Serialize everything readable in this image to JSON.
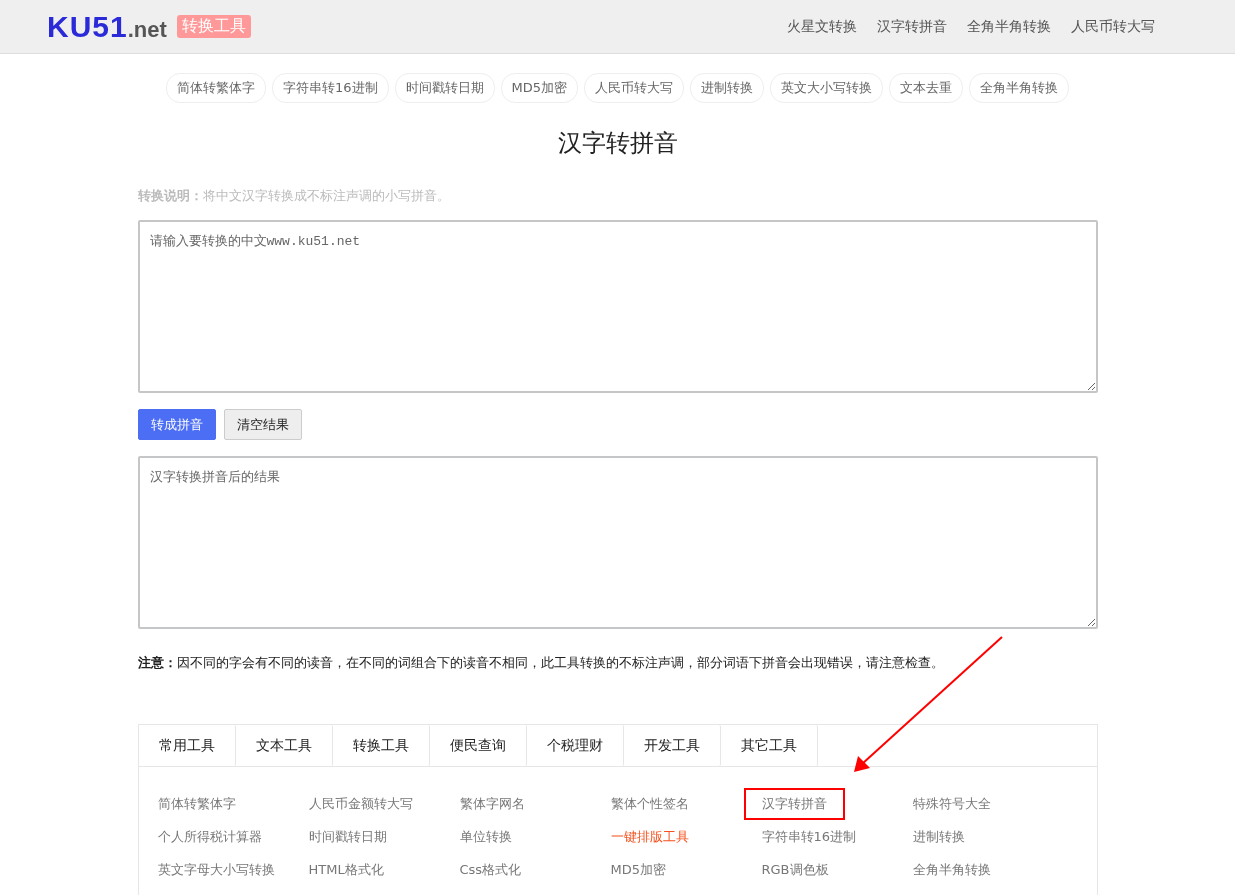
{
  "header": {
    "logo_main": "KU51",
    "logo_suffix": ".net",
    "logo_badge": "转换工具",
    "nav": [
      "火星文转换",
      "汉字转拼音",
      "全角半角转换",
      "人民币转大写"
    ]
  },
  "quick_links": [
    "简体转繁体字",
    "字符串转16进制",
    "时间戳转日期",
    "MD5加密",
    "人民币转大写",
    "进制转换",
    "英文大小写转换",
    "文本去重",
    "全角半角转换"
  ],
  "title": "汉字转拼音",
  "description": {
    "label": "转换说明：",
    "text": "将中文汉字转换成不标注声调的小写拼音。"
  },
  "input": {
    "placeholder": "请输入要转换的中文www.ku51.net"
  },
  "buttons": [
    {
      "label": "转成拼音",
      "kind": "primary"
    },
    {
      "label": "清空结果",
      "kind": "secondary"
    }
  ],
  "output": {
    "placeholder": "汉字转换拼音后的结果"
  },
  "note": {
    "label": "注意：",
    "text": "因不同的字会有不同的读音，在不同的词组合下的读音不相同，此工具转换的不标注声调，部分词语下拼音会出现错误，请注意检查。"
  },
  "tool_tabs": [
    "常用工具",
    "文本工具",
    "转换工具",
    "便民查询",
    "个税理财",
    "开发工具",
    "其它工具"
  ],
  "tool_links": [
    {
      "label": "简体转繁体字",
      "highlighted": false,
      "annotated": false
    },
    {
      "label": "人民币金额转大写",
      "highlighted": false,
      "annotated": false
    },
    {
      "label": "繁体字网名",
      "highlighted": false,
      "annotated": false
    },
    {
      "label": "繁体个性签名",
      "highlighted": false,
      "annotated": false
    },
    {
      "label": "汉字转拼音",
      "highlighted": false,
      "annotated": true
    },
    {
      "label": "特殊符号大全",
      "highlighted": false,
      "annotated": false
    },
    {
      "label": "个人所得税计算器",
      "highlighted": false,
      "annotated": false
    },
    {
      "label": "时间戳转日期",
      "highlighted": false,
      "annotated": false
    },
    {
      "label": "单位转换",
      "highlighted": false,
      "annotated": false
    },
    {
      "label": "一键排版工具",
      "highlighted": true,
      "annotated": false
    },
    {
      "label": "字符串转16进制",
      "highlighted": false,
      "annotated": false
    },
    {
      "label": "进制转换",
      "highlighted": false,
      "annotated": false
    },
    {
      "label": "英文字母大小写转换",
      "highlighted": false,
      "annotated": false
    },
    {
      "label": "HTML格式化",
      "highlighted": false,
      "annotated": false
    },
    {
      "label": "Css格式化",
      "highlighted": false,
      "annotated": false
    },
    {
      "label": "MD5加密",
      "highlighted": false,
      "annotated": false
    },
    {
      "label": "RGB调色板",
      "highlighted": false,
      "annotated": false
    },
    {
      "label": "全角半角转换",
      "highlighted": false,
      "annotated": false
    }
  ],
  "annotation_arrow": true
}
